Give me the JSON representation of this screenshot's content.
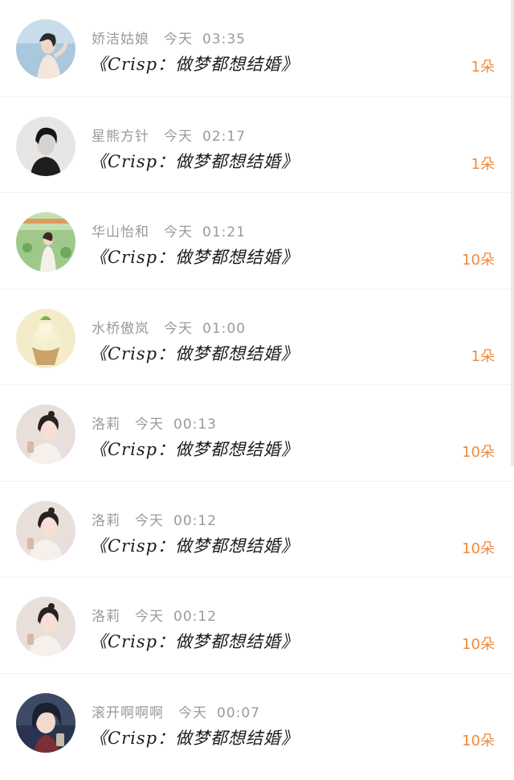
{
  "messages": [
    {
      "name": "娇洁姑娘",
      "day": "今天",
      "time": "03:35",
      "title": "《Crisp：做梦都想结婚》",
      "count": "1朵",
      "avatar_icon": "girl-sky-avatar-icon"
    },
    {
      "name": "星熊方针",
      "day": "今天",
      "time": "02:17",
      "title": "《Crisp：做梦都想结婚》",
      "count": "1朵",
      "avatar_icon": "boy-bw-avatar-icon"
    },
    {
      "name": "华山怡和",
      "day": "今天",
      "time": "01:21",
      "title": "《Crisp：做梦都想结婚》",
      "count": "10朵",
      "avatar_icon": "girl-garden-avatar-icon"
    },
    {
      "name": "水桥傲岚",
      "day": "今天",
      "time": "01:00",
      "title": "《Crisp：做梦都想结婚》",
      "count": "1朵",
      "avatar_icon": "cupcake-avatar-icon"
    },
    {
      "name": "洛莉",
      "day": "今天",
      "time": "00:13",
      "title": "《Crisp：做梦都想结婚》",
      "count": "10朵",
      "avatar_icon": "girl-portrait-avatar-icon"
    },
    {
      "name": "洛莉",
      "day": "今天",
      "time": "00:12",
      "title": "《Crisp：做梦都想结婚》",
      "count": "10朵",
      "avatar_icon": "girl-portrait-avatar-icon"
    },
    {
      "name": "洛莉",
      "day": "今天",
      "time": "00:12",
      "title": "《Crisp：做梦都想结婚》",
      "count": "10朵",
      "avatar_icon": "girl-portrait-avatar-icon"
    },
    {
      "name": "滚开啊啊啊",
      "day": "今天",
      "time": "00:07",
      "title": "《Crisp：做梦都想结婚》",
      "count": "10朵",
      "avatar_icon": "anime-girl-avatar-icon"
    }
  ],
  "colors": {
    "count_accent": "#f08a3c",
    "meta_gray": "#9a9a9a",
    "title_text": "#1c1c1c"
  }
}
